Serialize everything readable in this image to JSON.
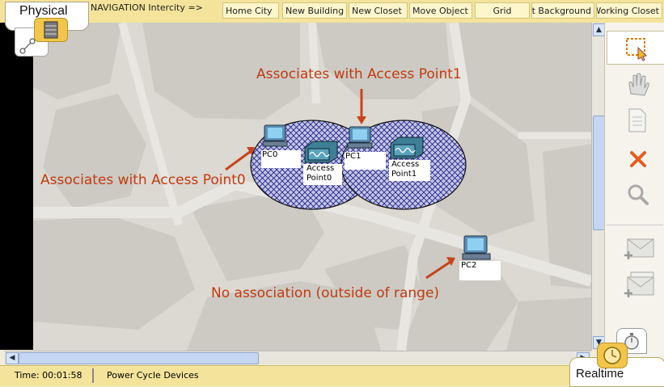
{
  "mode_tab": {
    "label": "Physical"
  },
  "navigation": {
    "label": "NAVIGATION  Intercity =>",
    "buttons": [
      "Home City",
      "New Building",
      "New Closet",
      "Move Object",
      "Grid",
      "Set Background",
      "Working Closet"
    ]
  },
  "annotations": {
    "ap1": "Associates with Access Point1",
    "ap0": "Associates with Access Point0",
    "none": "No association (outside of range)"
  },
  "devices": {
    "pc0": "PC0",
    "pc1": "PC1",
    "pc2": "PC2",
    "ap0_line1": "Access",
    "ap0_line2": "Point0",
    "ap1_line1": "Access",
    "ap1_line2": "Point1"
  },
  "right_tools": [
    "select-tool",
    "move-hand-tool",
    "place-note-tool",
    "delete-tool",
    "inspect-tool",
    "add-simple-pdu-tool",
    "add-complex-pdu-tool"
  ],
  "status": {
    "time": "Time: 00:01:58",
    "power_cycle": "Power Cycle Devices",
    "realtime": "Realtime"
  },
  "colors": {
    "accent_bar": "#f4e39a",
    "annotation_text": "#c23a10",
    "arrow": "#c8431b",
    "range_fill": "#b9bde4",
    "range_hatch": "#1a1a7a"
  }
}
